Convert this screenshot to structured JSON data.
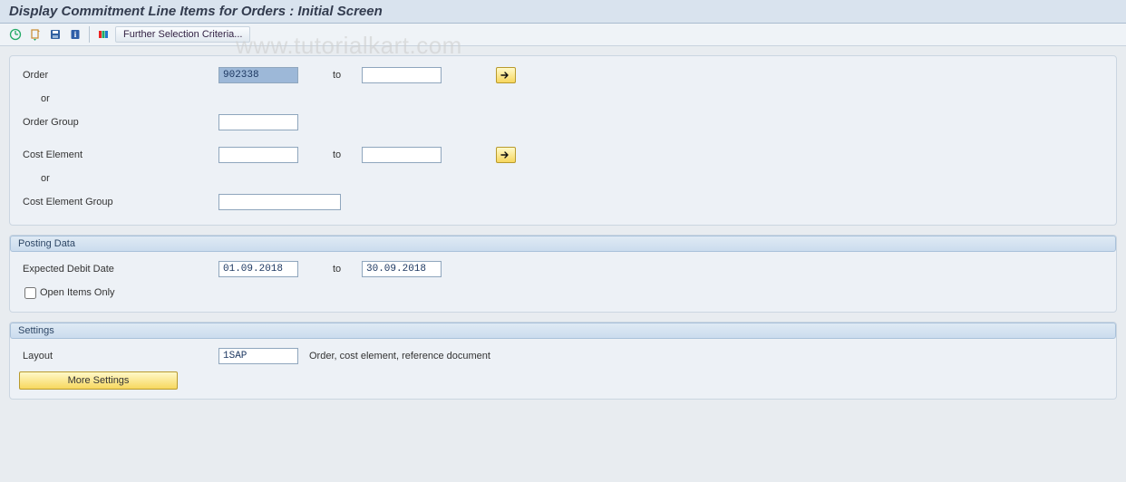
{
  "title": "Display Commitment Line Items for Orders : Initial Screen",
  "watermark": "www.tutorialkart.com",
  "toolbar": {
    "further_label": "Further Selection Criteria..."
  },
  "selection": {
    "order_label": "Order",
    "order_value": "902338",
    "or_label": "or",
    "order_group_label": "Order Group",
    "order_group_value": "",
    "order_to_value": "",
    "to_label": "to",
    "cost_element_label": "Cost Element",
    "cost_element_value": "",
    "cost_element_to_value": "",
    "cost_element_group_label": "Cost Element Group",
    "cost_element_group_value": ""
  },
  "posting": {
    "title": "Posting Data",
    "expected_debit_label": "Expected Debit Date",
    "from_value": "01.09.2018",
    "to_label": "to",
    "to_value": "30.09.2018",
    "open_items_label": "Open Items Only",
    "open_items_checked": false
  },
  "settings": {
    "title": "Settings",
    "layout_label": "Layout",
    "layout_value": "1SAP",
    "layout_description": "Order, cost element, reference document",
    "more_settings_label": "More Settings"
  }
}
